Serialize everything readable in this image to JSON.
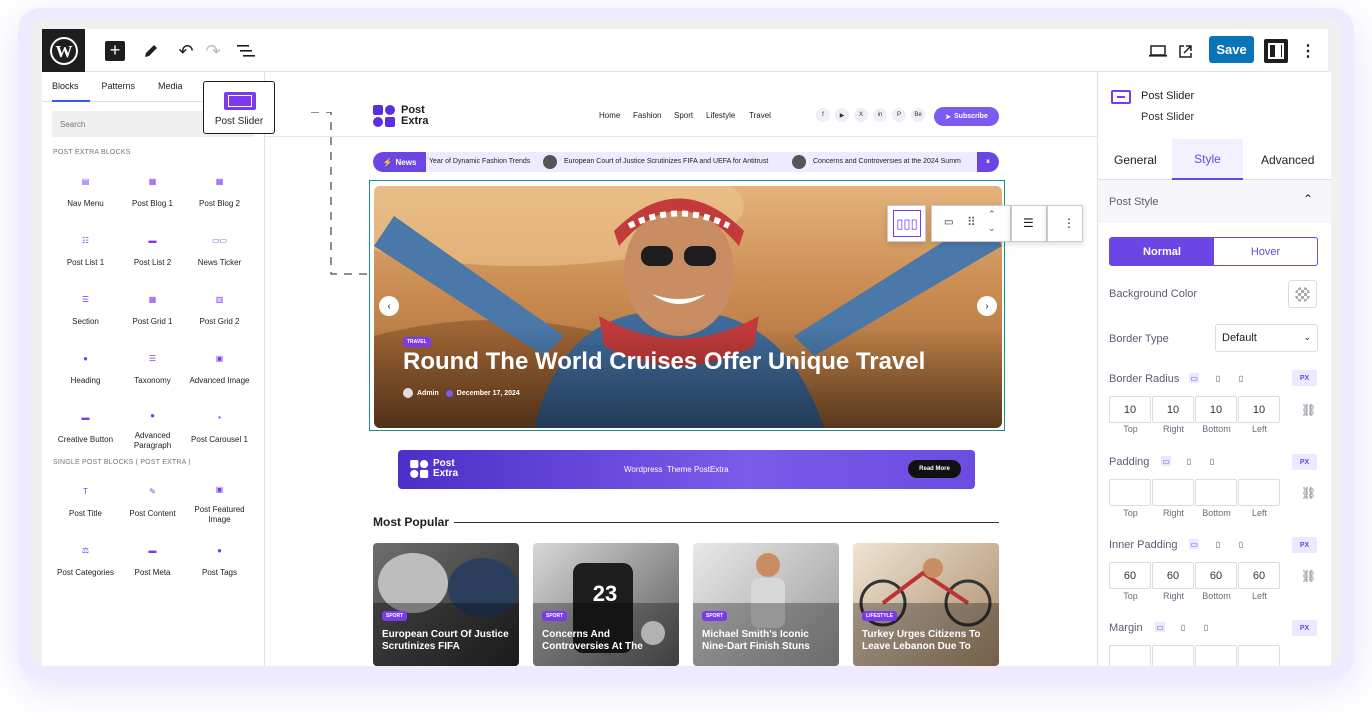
{
  "toolbar": {
    "save_label": "Save"
  },
  "tooltip": {
    "label": "Post Slider"
  },
  "inserter": {
    "tabs": [
      "Blocks",
      "Patterns",
      "Media"
    ],
    "search_placeholder": "Search",
    "section1": "POST EXTRA BLOCKS",
    "blocks": [
      {
        "label": "Nav Menu"
      },
      {
        "label": "Post Blog 1"
      },
      {
        "label": "Post Blog 2"
      },
      {
        "label": "Post List 1"
      },
      {
        "label": "Post List 2"
      },
      {
        "label": "News Ticker"
      },
      {
        "label": "Section"
      },
      {
        "label": "Post Grid 1"
      },
      {
        "label": "Post Grid 2"
      },
      {
        "label": "Heading"
      },
      {
        "label": "Taxonomy"
      },
      {
        "label": "Advanced Image"
      },
      {
        "label": "Creative Button"
      },
      {
        "label": "Advanced Paragraph"
      },
      {
        "label": "Post Carousel 1"
      }
    ],
    "section2": "SINGLE POST BLOCKS ( POST EXTRA )",
    "single_blocks": [
      {
        "label": "Post Title"
      },
      {
        "label": "Post Content"
      },
      {
        "label": "Post Featured Image"
      },
      {
        "label": "Post Categories"
      },
      {
        "label": "Post Meta"
      },
      {
        "label": "Post Tags"
      }
    ]
  },
  "site": {
    "logo_line1": "Post",
    "logo_line2": "Extra",
    "nav": [
      "Home",
      "Fashion",
      "Sport",
      "Lifestyle",
      "Travel"
    ],
    "social": [
      "f",
      "▶",
      "X",
      "in",
      "P",
      "Be"
    ],
    "subscribe": "Subscribe",
    "ticker_label": "News",
    "ticker_items": [
      "Year of Dynamic Fashion Trends",
      "European Court of Justice Scrutinizes FIFA and UEFA for Antitrust",
      "Concerns and Controversies at the 2024 Summ"
    ],
    "slide": {
      "category": "TRAVEL",
      "title": "Round The World Cruises Offer Unique Travel",
      "author": "Admin",
      "date": "December 17, 2024"
    },
    "banner": {
      "logo_line1": "Post",
      "logo_line2": "Extra",
      "text": "Wordpress  Theme PostExtra",
      "button": "Read More"
    },
    "section_title": "Most Popular",
    "cards": [
      {
        "category": "SPORT",
        "title": "European Court Of Justice Scrutinizes FIFA"
      },
      {
        "category": "SPORT",
        "title": "Concerns And Controversies At The"
      },
      {
        "category": "SPORT",
        "title": "Michael Smith's Iconic Nine-Dart Finish Stuns"
      },
      {
        "category": "LIFESTYLE",
        "title": "Turkey Urges Citizens To Leave Lebanon Due To"
      }
    ]
  },
  "panel": {
    "block_name": "Post Slider",
    "block_sub": "Post Slider",
    "tabs": [
      "General",
      "Style",
      "Advanced"
    ],
    "active_tab": "Style",
    "section": "Post Style",
    "state_tabs": [
      "Normal",
      "Hover"
    ],
    "bg_color_label": "Background Color",
    "border_type_label": "Border Type",
    "border_type_value": "Default",
    "border_radius_label": "Border Radius",
    "border_radius": [
      "10",
      "10",
      "10",
      "10"
    ],
    "sides": [
      "Top",
      "Right",
      "Bottom",
      "Left"
    ],
    "padding_label": "Padding",
    "padding": [
      "",
      "",
      "",
      ""
    ],
    "inner_padding_label": "Inner Padding",
    "inner_padding": [
      "60",
      "60",
      "60",
      "60"
    ],
    "margin_label": "Margin",
    "unit": "PX"
  },
  "colors": {
    "accent": "#7c3aed",
    "save": "#0a74b8",
    "wp": "#1e1e1e"
  }
}
